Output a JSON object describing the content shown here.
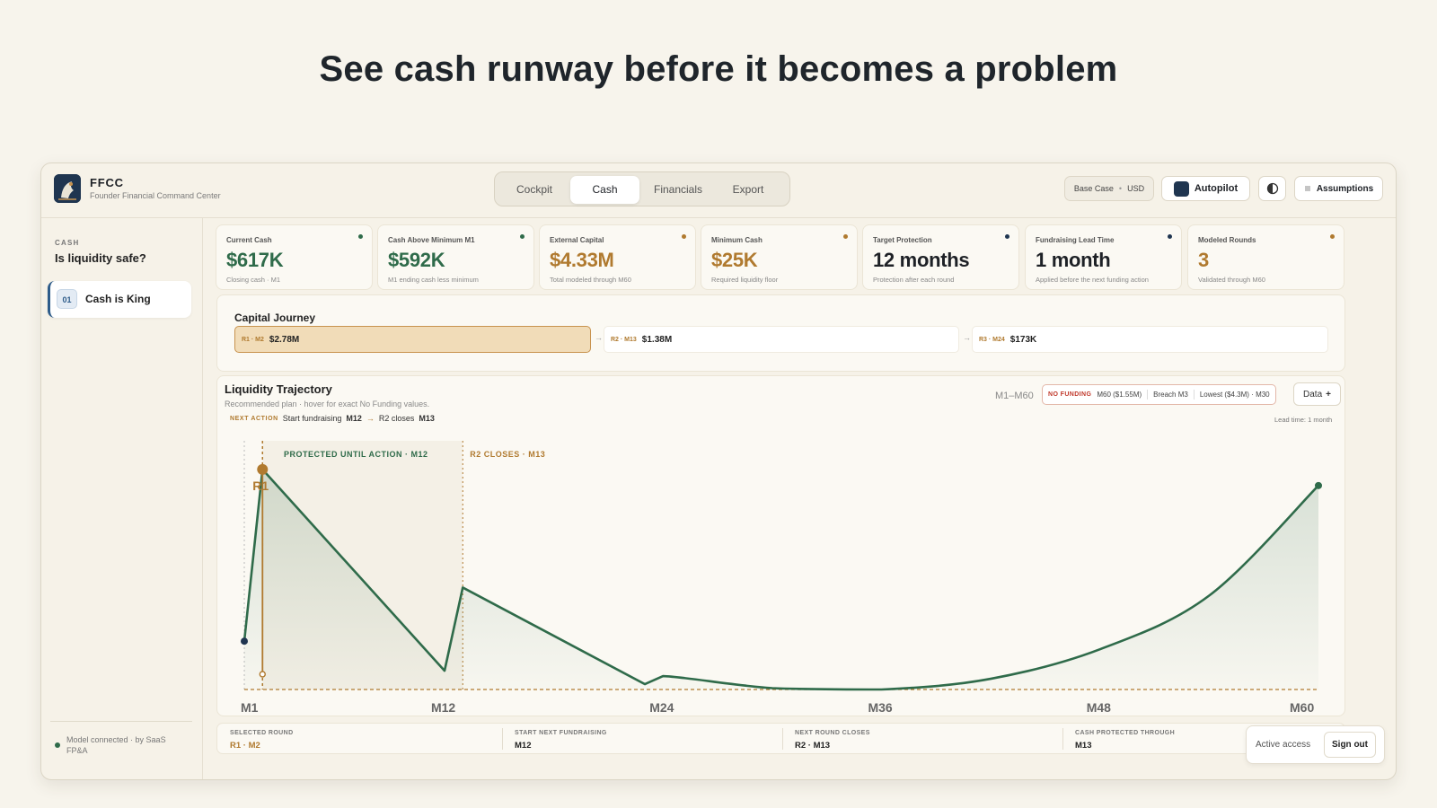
{
  "hero": {
    "title": "See cash runway before it becomes a problem"
  },
  "topbar": {
    "brand": "FFCC",
    "brand_sub": "Founder Financial Command Center",
    "tabs": [
      {
        "label": "Cockpit"
      },
      {
        "label": "Cash",
        "active": true
      },
      {
        "label": "Financials"
      },
      {
        "label": "Export"
      }
    ],
    "scenario": {
      "label": "Base Case",
      "sep": "•",
      "currency": "USD"
    },
    "autopilot": {
      "label": "Autopilot",
      "icon": "autopilot-icon"
    },
    "theme_icon": "theme-toggle-icon",
    "assumptions": {
      "icon": "menu-lines-icon",
      "label": "Assumptions"
    }
  },
  "sidebar": {
    "kicker": "CASH",
    "question": "Is liquidity safe?",
    "items": [
      {
        "num": "01",
        "label": "Cash is King",
        "active": true
      }
    ],
    "status": "Model connected · by SaaS FP&A"
  },
  "kpis": [
    {
      "label": "Current Cash",
      "value": "$617K",
      "sub": "Closing cash · M1",
      "color": "#2f6b4a"
    },
    {
      "label": "Cash Above Minimum M1",
      "value": "$592K",
      "sub": "M1 ending cash less minimum",
      "color": "#2f6b4a"
    },
    {
      "label": "External Capital",
      "value": "$4.33M",
      "sub": "Total modeled through M60",
      "color": "#b07a2f"
    },
    {
      "label": "Minimum Cash",
      "value": "$25K",
      "sub": "Required liquidity floor",
      "color": "#b07a2f"
    },
    {
      "label": "Target Protection",
      "value": "12 months",
      "sub": "Protection after each round",
      "color": "#1f3550"
    },
    {
      "label": "Fundraising Lead Time",
      "value": "1 month",
      "sub": "Applied before the next funding action",
      "color": "#1f3550"
    },
    {
      "label": "Modeled Rounds",
      "value": "3",
      "sub": "Validated through M60",
      "color": "#b07a2f"
    }
  ],
  "journey": {
    "title": "Capital Journey",
    "segments": [
      {
        "tag": "R1 · M2",
        "amount": "$2.78M",
        "active": true
      },
      {
        "tag": "R2 · M13",
        "amount": "$1.38M"
      },
      {
        "tag": "R3 · M24",
        "amount": "$173K"
      }
    ],
    "arrow": "→"
  },
  "chart_panel": {
    "title": "Liquidity Trajectory",
    "subtitle": "Recommended plan · hover for exact No Funding values.",
    "next_action": {
      "label": "NEXT ACTION",
      "step1_prefix": "Start fundraising",
      "step1_value": "M12",
      "arrow": "→",
      "step2_prefix": "R2 closes",
      "step2_value": "M13"
    },
    "range": "M1–M60",
    "no_funding": {
      "label": "NO FUNDING",
      "m60": "M60 ($1.55M)",
      "breach": "Breach M3",
      "lowest": "Lowest ($4.3M) · M30"
    },
    "data_button": {
      "label": "Data",
      "icon": "+"
    },
    "lead_time": "Lead time: 1 month"
  },
  "chart_data": {
    "type": "line",
    "title": "Liquidity Trajectory",
    "x_ticks": [
      "M1",
      "M12",
      "M24",
      "M36",
      "M48",
      "M60"
    ],
    "x": [
      1,
      2,
      12,
      13,
      23,
      24,
      30,
      36,
      42,
      48,
      54,
      60
    ],
    "values_relative": [
      0.18,
      0.82,
      0.07,
      0.38,
      0.02,
      0.05,
      0.005,
      0.0,
      0.04,
      0.15,
      0.35,
      0.76
    ],
    "annotations": [
      {
        "text": "PROTECTED UNTIL ACTION · M12",
        "x": 12
      },
      {
        "text": "R2 CLOSES · M13",
        "x": 13
      },
      {
        "text": "R1",
        "x": 2
      }
    ],
    "grid": false,
    "min_cash_line": true,
    "colors": {
      "line": "#2f6b4a",
      "marker": "#b07a2f",
      "protected_band": "#efeadb"
    }
  },
  "bottombar": [
    {
      "label": "SELECTED ROUND",
      "value": "R1 · M2",
      "accent": true
    },
    {
      "label": "START NEXT FUNDRAISING",
      "value": "M12"
    },
    {
      "label": "NEXT ROUND CLOSES",
      "value": "R2 · M13"
    },
    {
      "label": "CASH PROTECTED THROUGH",
      "value": "M13"
    }
  ],
  "access": {
    "label": "Active access",
    "signout": "Sign out"
  }
}
